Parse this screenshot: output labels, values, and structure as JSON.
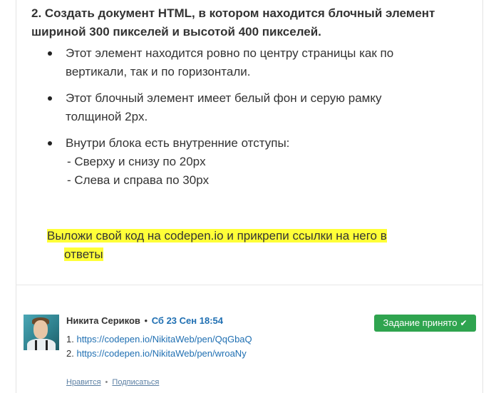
{
  "task": {
    "title_line1": "2. Создать документ HTML, в котором находится блочный элемент",
    "title_line2": "шириной 300 пикселей и высотой 400 пикселей.",
    "bullets": [
      {
        "line1": "Этот элемент находится ровно по центру страницы как по",
        "line2": "вертикали, так и по горизонтали."
      },
      {
        "line1": "Этот блочный элемент имеет белый фон и серую рамку",
        "line2": "толщиной 2px."
      },
      {
        "line1": "Внутри блока есть внутренние отступы:",
        "line2": "- Сверху и снизу по 20px",
        "line3": "- Слева и справа по 30px"
      }
    ],
    "highlight_line1": "Выложи свой код на codepen.io и прикрепи ссылки на него в",
    "highlight_line2": "ответы"
  },
  "comment": {
    "author": "Никита Сериков",
    "separator": "•",
    "date": "Сб 23 Сен 18:54",
    "links": [
      {
        "prefix": "1. ",
        "url": "https://codepen.io/NikitaWeb/pen/QqGbaQ"
      },
      {
        "prefix": "2. ",
        "url": "https://codepen.io/NikitaWeb/pen/wroaNy"
      }
    ],
    "like_label": "Нравится",
    "dot": "•",
    "subscribe_label": "Подписаться",
    "status_badge": "Задание принято",
    "status_icon": "check-icon"
  },
  "colors": {
    "highlight": "#ffff38",
    "badge": "#2fa44f",
    "link": "#1f6fb2"
  }
}
